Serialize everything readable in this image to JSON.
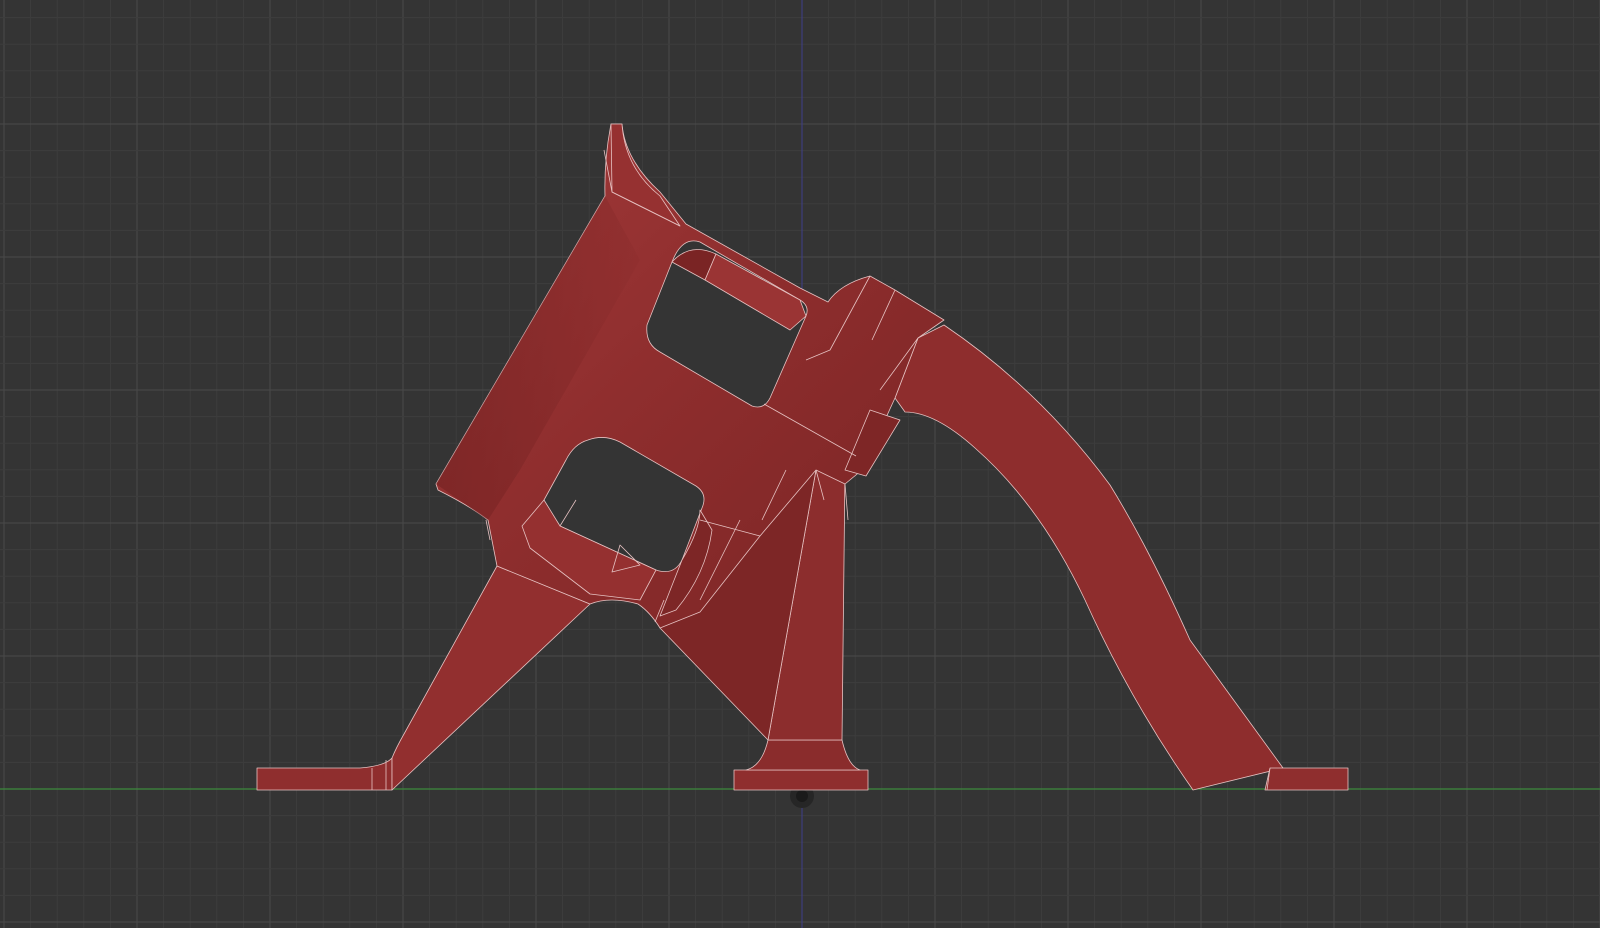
{
  "viewport": {
    "view": "front",
    "background_color": "#343434",
    "minor_grid_color": "#3d3d3d",
    "major_grid_color": "#4a4a4a",
    "ground_axis_color": "#3c8a3c",
    "vertical_axis_color": "#3e3e8a"
  },
  "model": {
    "body_color": "#8f2e2e",
    "shade_color": "#6e1f1f",
    "highlight_color": "#a33a3a",
    "edge_color": "#e6c2c2"
  },
  "origin_marker": {
    "icon": "origin-icon"
  }
}
